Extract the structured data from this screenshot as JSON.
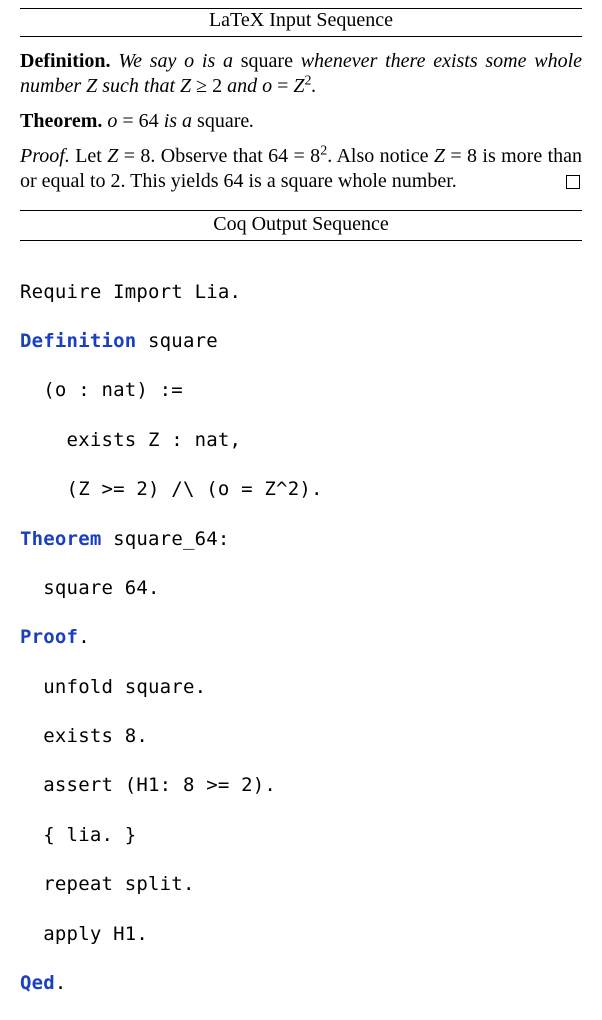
{
  "section1": {
    "title": "LaTeX Input Sequence"
  },
  "latex": {
    "def_label": "Definition.",
    "def_pre1": "We say ",
    "def_var_o": "o",
    "def_mid1": " is a ",
    "def_square_word": "square",
    "def_mid2": " whenever there exists some whole number ",
    "def_var_Z": "Z",
    "def_mid3": " such that ",
    "def_math1_lhs": "Z",
    "def_math1_op": " ≥ 2",
    "def_mid4": " and ",
    "def_math2_o": "o",
    "def_math2_eq": " = ",
    "def_math2_Z": "Z",
    "def_math2_exp": "2",
    "def_end": ".",
    "thm_label": "Theorem.",
    "thm_pre": " ",
    "thm_var_o": "o",
    "thm_eq": " = 64",
    "thm_mid": " is a ",
    "thm_square_word": "square",
    "thm_end": ".",
    "proof_label": "Proof.",
    "proof_t1": "Let ",
    "proof_m1_Z": "Z",
    "proof_m1_eq": " = 8",
    "proof_t2": ". Observe that ",
    "proof_m2_a": "64 = 8",
    "proof_m2_exp": "2",
    "proof_t3": ". Also notice ",
    "proof_m3_Z": "Z",
    "proof_m3_eq": " = 8",
    "proof_t4": " is more than or equal to 2.  This yields 64 is a square whole number."
  },
  "section2": {
    "title": "Coq Output Sequence"
  },
  "coq": {
    "l01a": "Require Import Lia.",
    "l02a": "Definition",
    "l02b": " square",
    "l03a": "  (o : nat) :=",
    "l04a": "    exists Z : nat,",
    "l05a": "    (Z >= 2) /\\ (o = Z^2).",
    "l06a": "Theorem",
    "l06b": " square_64:",
    "l07a": "  square 64.",
    "l08a": "Proof",
    "l08b": ".",
    "l09a": "  unfold square.",
    "l10a": "  exists 8.",
    "l11a": "  assert (H1: 8 >= 2).",
    "l12a": "  { lia. }",
    "l13a": "  repeat split.",
    "l14a": "  apply H1.",
    "l15a": "Qed",
    "l15b": "."
  }
}
